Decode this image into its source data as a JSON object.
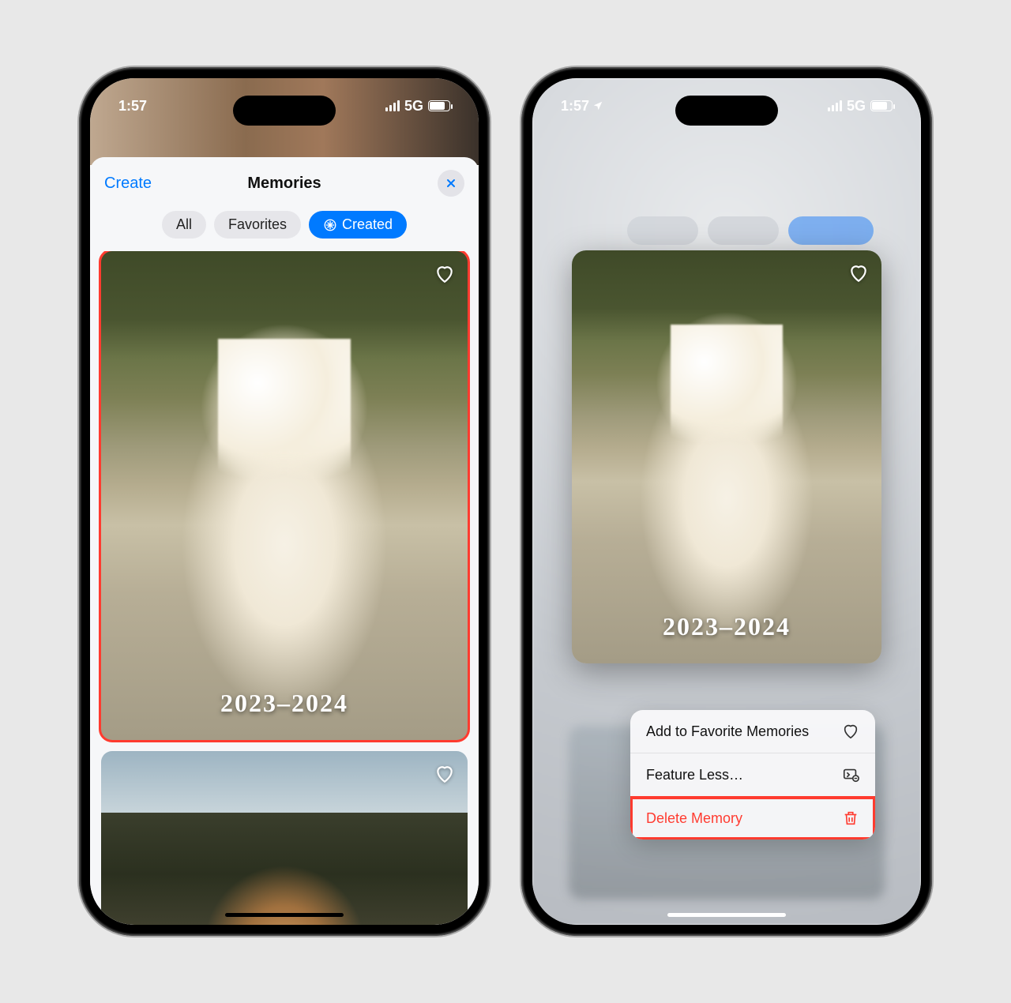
{
  "status": {
    "time": "1:57",
    "network": "5G"
  },
  "screen1": {
    "header": {
      "create": "Create",
      "title": "Memories"
    },
    "filters": {
      "all": "All",
      "favorites": "Favorites",
      "created": "Created"
    },
    "card": {
      "title": "2023–2024"
    }
  },
  "screen2": {
    "card": {
      "title": "2023–2024"
    },
    "menu": {
      "add_favorite": "Add to Favorite Memories",
      "feature_less": "Feature Less…",
      "delete": "Delete Memory"
    }
  }
}
